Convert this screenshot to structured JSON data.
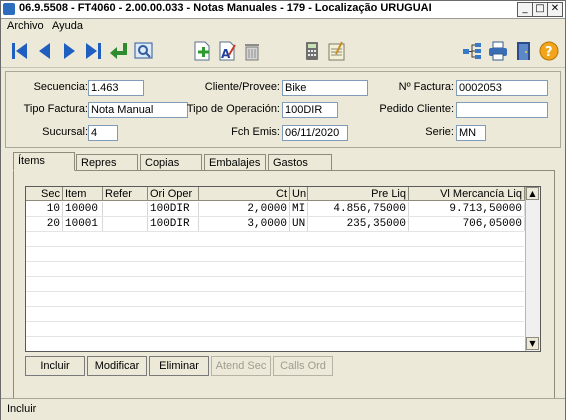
{
  "window": {
    "title": "06.9.5508 - FT4060 - 2.00.00.033 - Notas Manuales - 179 - Localização URUGUAI",
    "controls": [
      "_",
      "□",
      "✕"
    ]
  },
  "menu": [
    "Archivo",
    "Ayuda"
  ],
  "toolbar": {
    "left_icons": [
      "first-record-icon",
      "previous-record-icon",
      "next-record-icon",
      "last-record-icon",
      "confirm-enter-icon",
      "search-preview-icon",
      "new-record-icon",
      "edit-record-icon",
      "delete-record-icon",
      "calculator-icon",
      "notes-icon"
    ],
    "right_icons": [
      "tree-structure-icon",
      "printer-icon",
      "exit-door-icon",
      "help-icon"
    ],
    "help_glyph": "?"
  },
  "form": {
    "secuencia": {
      "label": "Secuencia:",
      "value": "1.463"
    },
    "cliente": {
      "label": "Cliente/Provee:",
      "value": "Bike"
    },
    "nro_factura": {
      "label": "Nº Factura:",
      "value": "0002053"
    },
    "tipo_factura": {
      "label": "Tipo Factura:",
      "value": "Nota Manual"
    },
    "tipo_operacion": {
      "label": "Tipo de Operación:",
      "value": "100DIR"
    },
    "pedido_cliente": {
      "label": "Pedido Cliente:",
      "value": ""
    },
    "sucursal": {
      "label": "Sucursal:",
      "value": "4"
    },
    "fch_emis": {
      "label": "Fch Emis:",
      "value": "06/11/2020"
    },
    "serie": {
      "label": "Serie:",
      "value": "MN"
    }
  },
  "tabs": [
    "Ítems",
    "Repres",
    "Copias",
    "Embalajes",
    "Gastos"
  ],
  "grid": {
    "columns": [
      "Sec",
      "Item",
      "Refer",
      "Ori Oper",
      "Ct",
      "Un",
      "Pre Liq",
      "Vl Mercancía Liq"
    ],
    "rows": [
      [
        "10",
        "10000",
        "",
        "100DIR",
        "2,0000",
        "MI",
        "4.856,75000",
        "9.713,50000"
      ],
      [
        "20",
        "10001",
        "",
        "100DIR",
        "3,0000",
        "UN",
        "235,35000",
        "706,05000"
      ]
    ]
  },
  "actions": {
    "incluir": "Incluir",
    "modificar": "Modificar",
    "eliminar": "Eliminar",
    "atend_sec": "Atend Sec",
    "calls_ord": "Calls Ord"
  },
  "status": "Incluir"
}
